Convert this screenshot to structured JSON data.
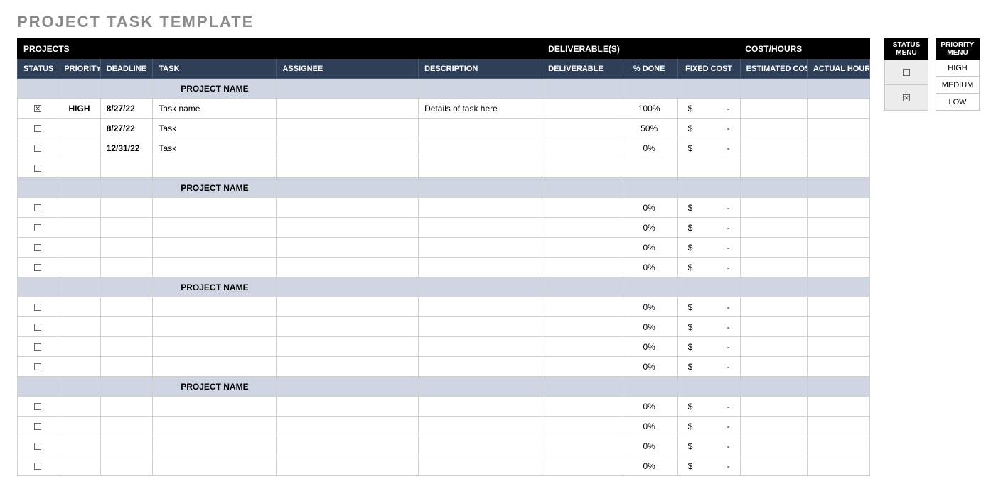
{
  "title": "PROJECT TASK TEMPLATE",
  "headers": {
    "projects": "PROJECTS",
    "deliverables": "DELIVERABLE(S)",
    "costhours": "COST/HOURS",
    "status": "STATUS",
    "priority": "PRIORITY",
    "deadline": "DEADLINE",
    "task": "TASK",
    "assignee": "ASSIGNEE",
    "description": "DESCRIPTION",
    "deliverable": "DELIVERABLE",
    "pct_done": "% DONE",
    "fixed_cost": "FIXED COST",
    "estimated_cost": "ESTIMATED COST",
    "actual_hours": "ACTUAL HOURS"
  },
  "groups": [
    {
      "name": "PROJECT NAME",
      "rows": [
        {
          "status": "checked",
          "priority": "HIGH",
          "deadline": "8/27/22",
          "task": "Task name",
          "assignee": "",
          "description": "Details of task here",
          "deliverable": "",
          "pct_done": "100%",
          "fixed_dollar": "$",
          "fixed_dash": "-",
          "estimated": "",
          "actual": ""
        },
        {
          "status": "empty",
          "priority": "",
          "deadline": "8/27/22",
          "task": "Task",
          "assignee": "",
          "description": "",
          "deliverable": "",
          "pct_done": "50%",
          "fixed_dollar": "$",
          "fixed_dash": "-",
          "estimated": "",
          "actual": ""
        },
        {
          "status": "empty",
          "priority": "",
          "deadline": "12/31/22",
          "task": "Task",
          "assignee": "",
          "description": "",
          "deliverable": "",
          "pct_done": "0%",
          "fixed_dollar": "$",
          "fixed_dash": "-",
          "estimated": "",
          "actual": ""
        },
        {
          "status": "empty",
          "priority": "",
          "deadline": "",
          "task": "",
          "assignee": "",
          "description": "",
          "deliverable": "",
          "pct_done": "",
          "fixed_dollar": "",
          "fixed_dash": "",
          "estimated": "",
          "actual": ""
        }
      ]
    },
    {
      "name": "PROJECT NAME",
      "rows": [
        {
          "status": "empty",
          "priority": "",
          "deadline": "",
          "task": "",
          "assignee": "",
          "description": "",
          "deliverable": "",
          "pct_done": "0%",
          "fixed_dollar": "$",
          "fixed_dash": "-",
          "estimated": "",
          "actual": ""
        },
        {
          "status": "empty",
          "priority": "",
          "deadline": "",
          "task": "",
          "assignee": "",
          "description": "",
          "deliverable": "",
          "pct_done": "0%",
          "fixed_dollar": "$",
          "fixed_dash": "-",
          "estimated": "",
          "actual": ""
        },
        {
          "status": "empty",
          "priority": "",
          "deadline": "",
          "task": "",
          "assignee": "",
          "description": "",
          "deliverable": "",
          "pct_done": "0%",
          "fixed_dollar": "$",
          "fixed_dash": "-",
          "estimated": "",
          "actual": ""
        },
        {
          "status": "empty",
          "priority": "",
          "deadline": "",
          "task": "",
          "assignee": "",
          "description": "",
          "deliverable": "",
          "pct_done": "0%",
          "fixed_dollar": "$",
          "fixed_dash": "-",
          "estimated": "",
          "actual": ""
        }
      ]
    },
    {
      "name": "PROJECT NAME",
      "rows": [
        {
          "status": "empty",
          "priority": "",
          "deadline": "",
          "task": "",
          "assignee": "",
          "description": "",
          "deliverable": "",
          "pct_done": "0%",
          "fixed_dollar": "$",
          "fixed_dash": "-",
          "estimated": "",
          "actual": ""
        },
        {
          "status": "empty",
          "priority": "",
          "deadline": "",
          "task": "",
          "assignee": "",
          "description": "",
          "deliverable": "",
          "pct_done": "0%",
          "fixed_dollar": "$",
          "fixed_dash": "-",
          "estimated": "",
          "actual": ""
        },
        {
          "status": "empty",
          "priority": "",
          "deadline": "",
          "task": "",
          "assignee": "",
          "description": "",
          "deliverable": "",
          "pct_done": "0%",
          "fixed_dollar": "$",
          "fixed_dash": "-",
          "estimated": "",
          "actual": ""
        },
        {
          "status": "empty",
          "priority": "",
          "deadline": "",
          "task": "",
          "assignee": "",
          "description": "",
          "deliverable": "",
          "pct_done": "0%",
          "fixed_dollar": "$",
          "fixed_dash": "-",
          "estimated": "",
          "actual": ""
        }
      ]
    },
    {
      "name": "PROJECT NAME",
      "rows": [
        {
          "status": "empty",
          "priority": "",
          "deadline": "",
          "task": "",
          "assignee": "",
          "description": "",
          "deliverable": "",
          "pct_done": "0%",
          "fixed_dollar": "$",
          "fixed_dash": "-",
          "estimated": "",
          "actual": ""
        },
        {
          "status": "empty",
          "priority": "",
          "deadline": "",
          "task": "",
          "assignee": "",
          "description": "",
          "deliverable": "",
          "pct_done": "0%",
          "fixed_dollar": "$",
          "fixed_dash": "-",
          "estimated": "",
          "actual": ""
        },
        {
          "status": "empty",
          "priority": "",
          "deadline": "",
          "task": "",
          "assignee": "",
          "description": "",
          "deliverable": "",
          "pct_done": "0%",
          "fixed_dollar": "$",
          "fixed_dash": "-",
          "estimated": "",
          "actual": ""
        },
        {
          "status": "empty",
          "priority": "",
          "deadline": "",
          "task": "",
          "assignee": "",
          "description": "",
          "deliverable": "",
          "pct_done": "0%",
          "fixed_dollar": "$",
          "fixed_dash": "-",
          "estimated": "",
          "actual": ""
        }
      ]
    }
  ],
  "status_menu": {
    "title": "STATUS MENU",
    "rows": [
      "empty",
      "checked"
    ]
  },
  "priority_menu": {
    "title": "PRIORITY MENU",
    "rows": [
      "HIGH",
      "MEDIUM",
      "LOW"
    ]
  }
}
